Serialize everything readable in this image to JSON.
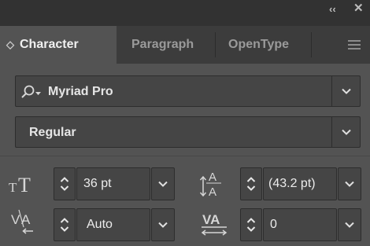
{
  "titlebar": {
    "collapse_glyph": "‹‹",
    "close_glyph": "✕"
  },
  "tabs": [
    {
      "label": "Character",
      "active": true,
      "sort_glyph": "◇"
    },
    {
      "label": "Paragraph",
      "active": false
    },
    {
      "label": "OpenType",
      "active": false
    }
  ],
  "font_family": {
    "value": "Myriad Pro",
    "icon": "search-icon"
  },
  "font_style": {
    "value": "Regular"
  },
  "font_size": {
    "value": "36 pt",
    "icon": "font-size-icon"
  },
  "leading": {
    "value": "(43.2 pt)",
    "icon": "leading-icon"
  },
  "kerning": {
    "value": "Auto",
    "icon": "kerning-icon"
  },
  "tracking": {
    "value": "0",
    "icon": "tracking-icon"
  },
  "colors": {
    "panel": "#535353",
    "field": "#454545",
    "tabbar": "#3c3c3c",
    "titlebar": "#323232"
  }
}
